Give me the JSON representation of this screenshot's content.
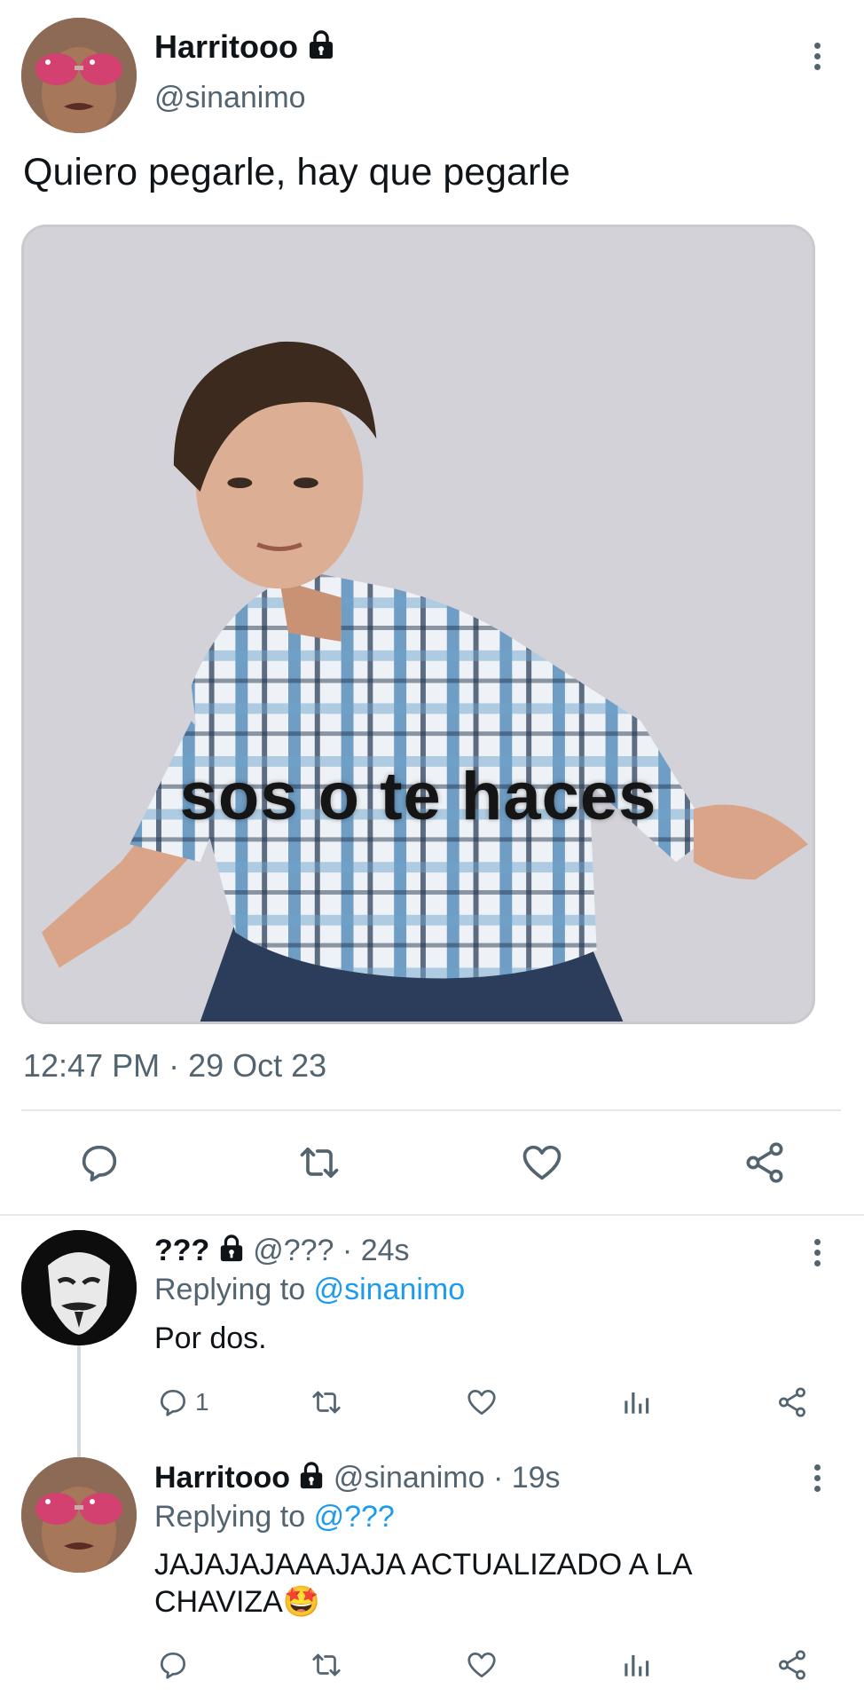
{
  "main_tweet": {
    "author_name": "Harritooo",
    "author_handle": "@sinanimo",
    "text": "Quiero pegarle, hay que pegarle",
    "media_caption": "sos o te haces",
    "timestamp": "12:47 PM · 29 Oct 23",
    "actions": [
      "reply-icon",
      "retweet-icon",
      "like-icon",
      "share-icon"
    ]
  },
  "replies": [
    {
      "author_name": "???",
      "author_handle": "@???",
      "time": "· 24s",
      "replying_prefix": "Replying to",
      "replying_to": "@sinanimo",
      "text": "Por dos.",
      "reply_count": "1"
    },
    {
      "author_name": "Harritooo",
      "author_handle": "@sinanimo",
      "time": "· 19s",
      "replying_prefix": "Replying to",
      "replying_to": "@???",
      "text_line1": "JAJAJAJAAAJAJA ACTUALIZADO A LA",
      "text_line2": "CHAVIZA🤩"
    }
  ],
  "colors": {
    "text": "#0f1419",
    "secondary": "#536471",
    "mention": "#1d9bf0",
    "divider": "#e4e8eb"
  }
}
